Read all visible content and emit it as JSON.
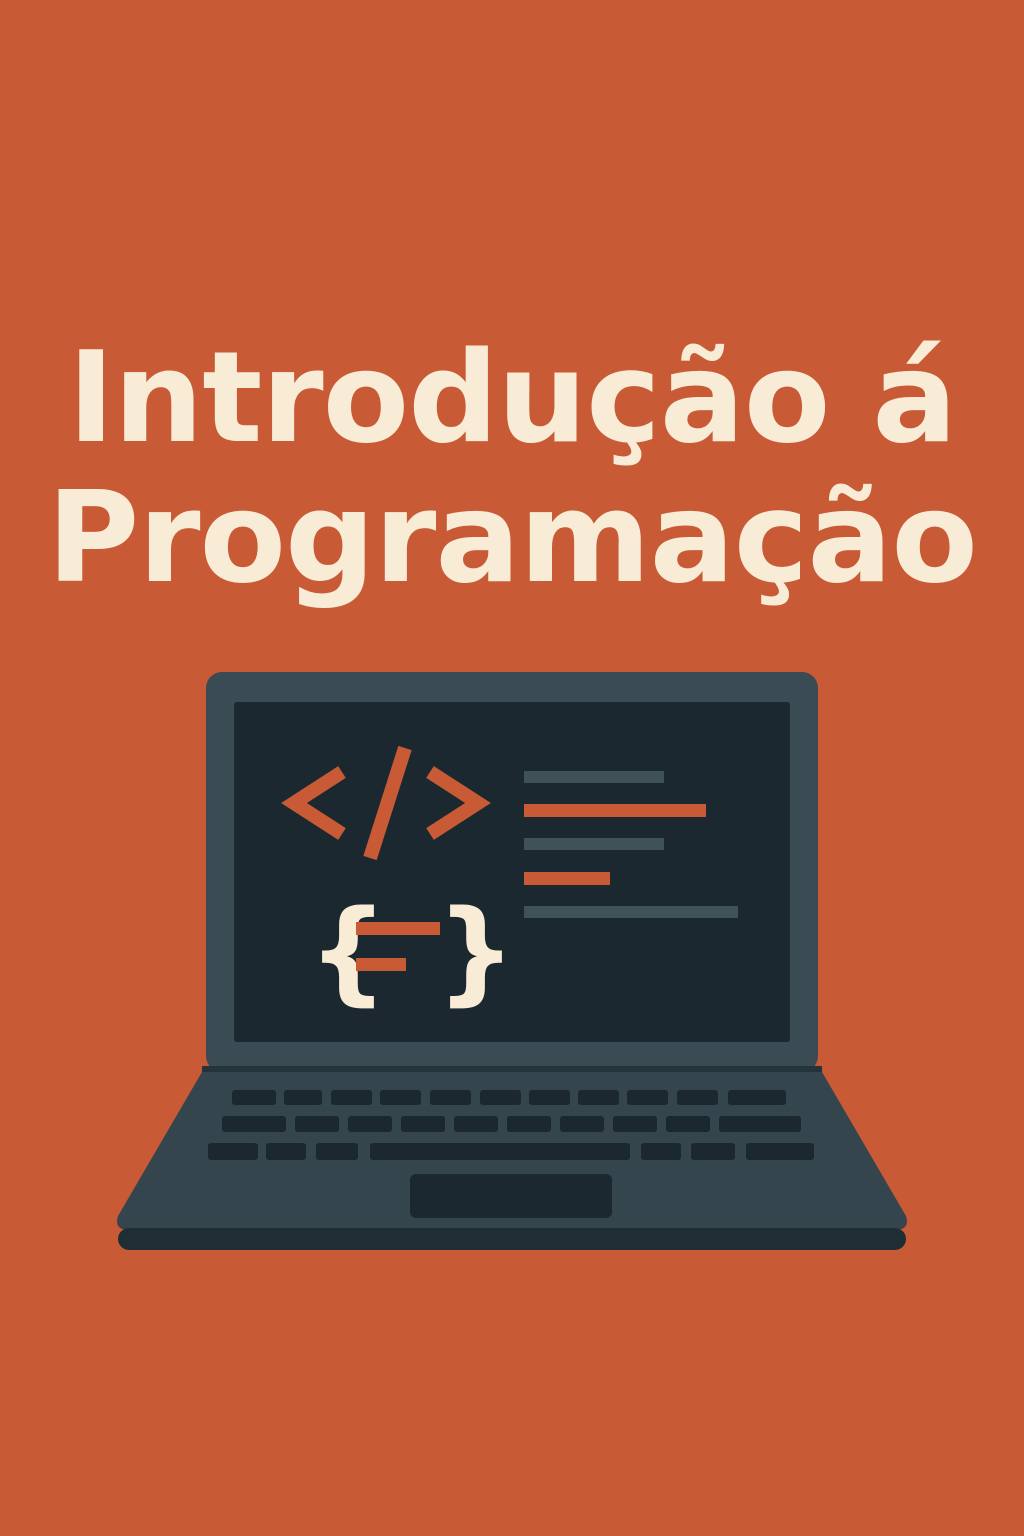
{
  "cover": {
    "title_line_1": "Introdução á",
    "title_line_2": "Programação"
  },
  "colors": {
    "background": "#c95a36",
    "title": "#f8ecd6",
    "laptop_frame": "#3a4b53",
    "screen": "#1b2830",
    "keyboard_keys": "#1b2830",
    "code_accent": "#c95a36",
    "code_line_muted": "#3f525a",
    "braces": "#f8ecd6"
  },
  "illustration": {
    "subject": "laptop",
    "icons": [
      "code-tag-icon",
      "curly-braces-icon"
    ]
  }
}
